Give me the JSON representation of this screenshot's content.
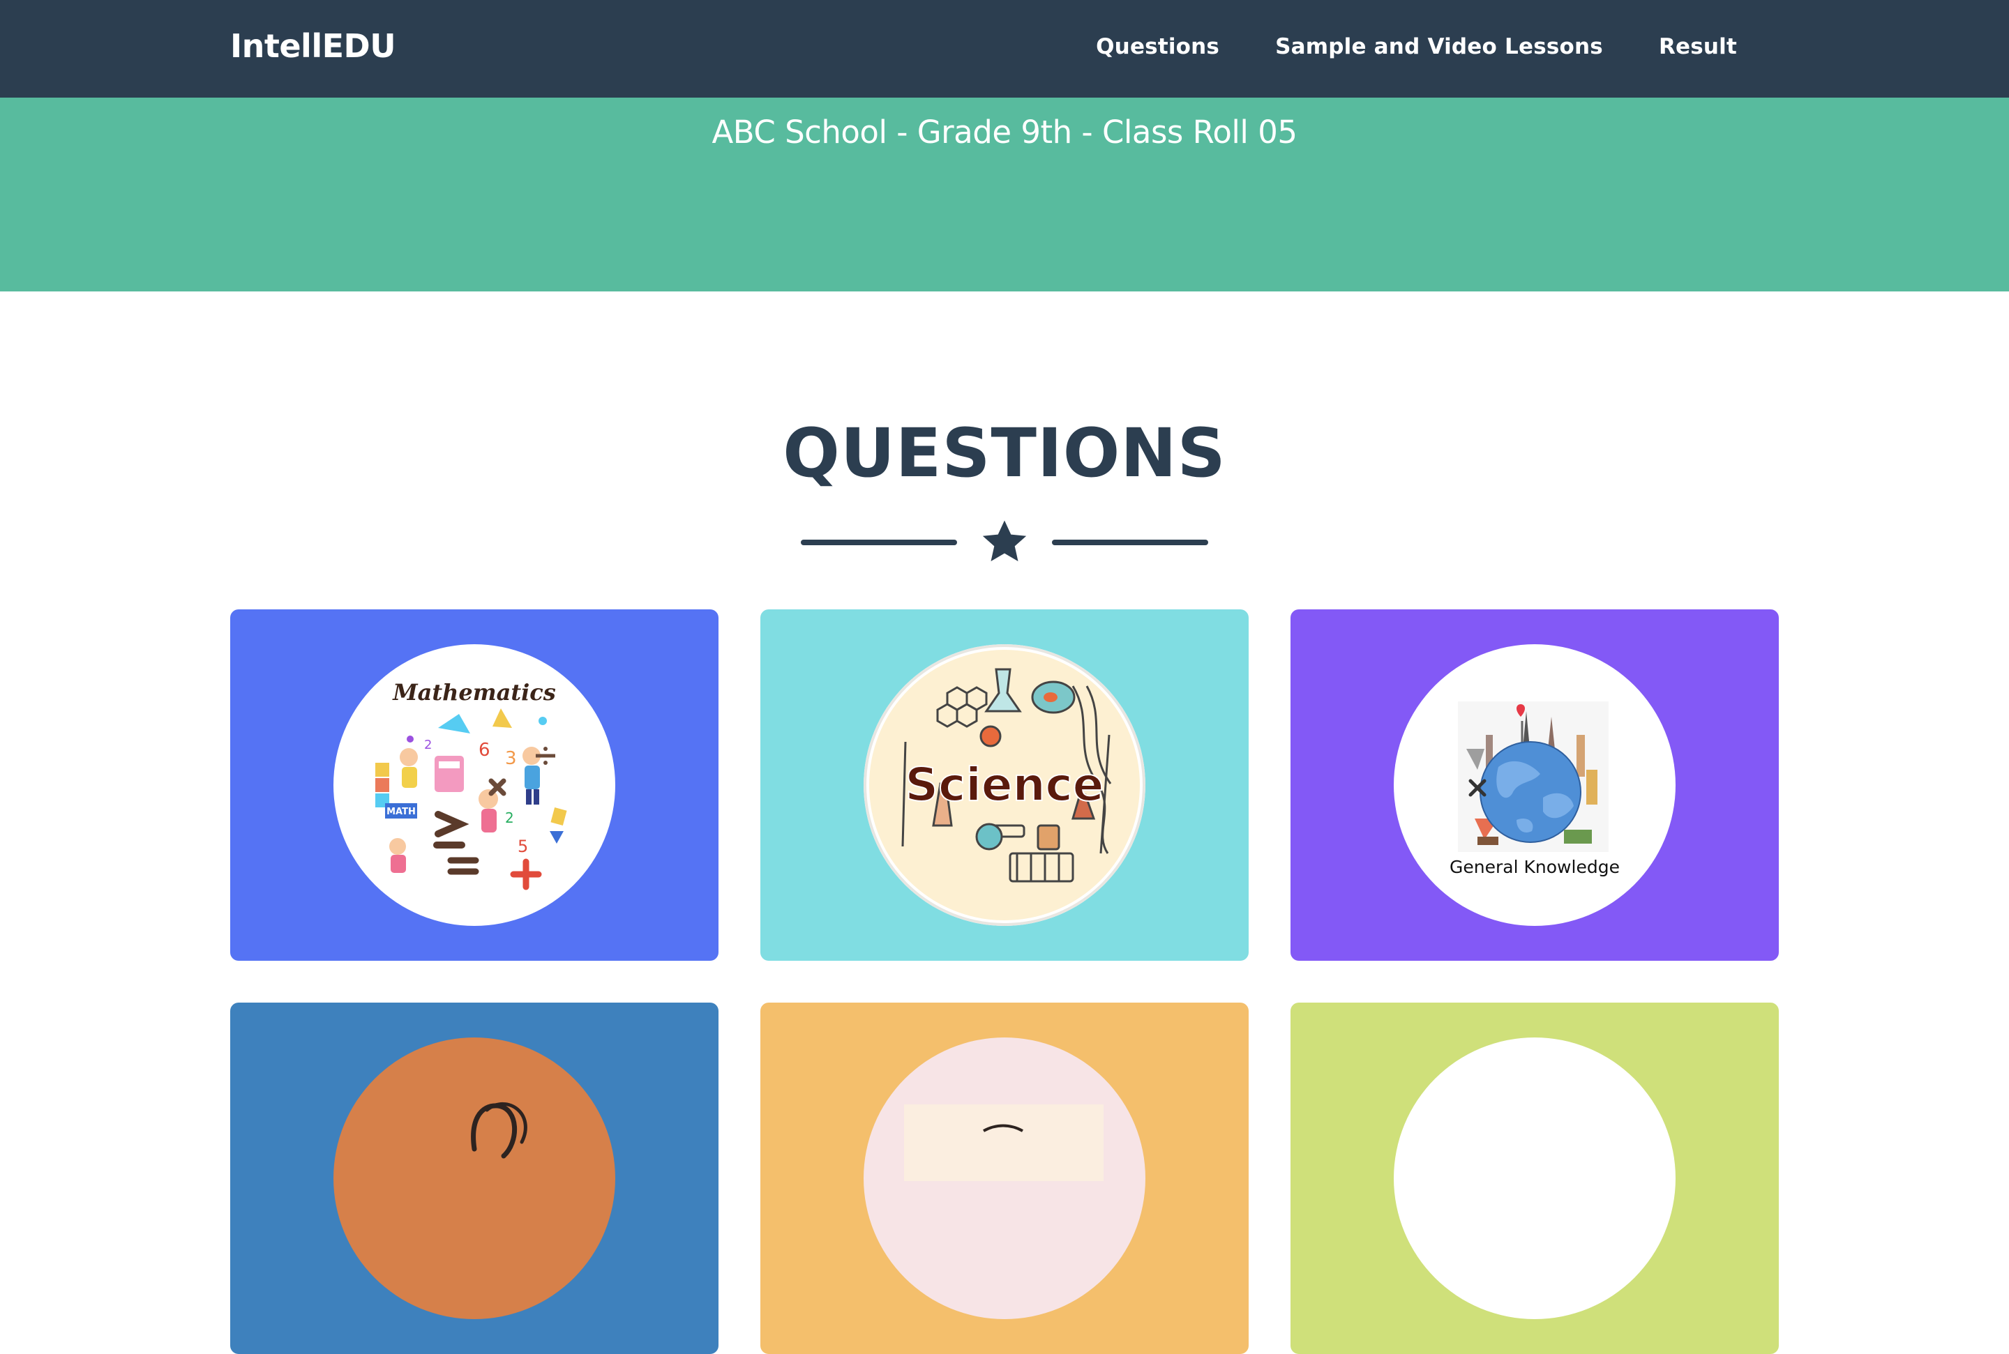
{
  "navbar": {
    "brand": "IntellEDU",
    "links": [
      {
        "label": "Questions"
      },
      {
        "label": "Sample and Video Lessons"
      },
      {
        "label": "Result"
      }
    ],
    "background": "#2c3e50"
  },
  "masthead": {
    "subtitle": "ABC School - Grade 9th - Class Roll 05",
    "background": "#58bb9e"
  },
  "questions_section": {
    "heading": "QUESTIONS",
    "divider_icon": "star-icon",
    "cards": [
      {
        "image_label": "Mathematics",
        "icon": "mathematics-illustration",
        "color": "#5573f4"
      },
      {
        "image_label": "Science",
        "icon": "science-illustration",
        "color": "#80dde2"
      },
      {
        "image_label": "General Knowledge",
        "icon": "globe-illustration",
        "color": "#8359f6"
      },
      {
        "image_label": "",
        "icon": "brain-illustration",
        "color": "#3e81bd"
      },
      {
        "image_label": "",
        "icon": "book-illustration",
        "color": "#f4bf6c"
      },
      {
        "image_label": "",
        "icon": "circle-illustration",
        "color": "#cfe07a"
      }
    ]
  }
}
